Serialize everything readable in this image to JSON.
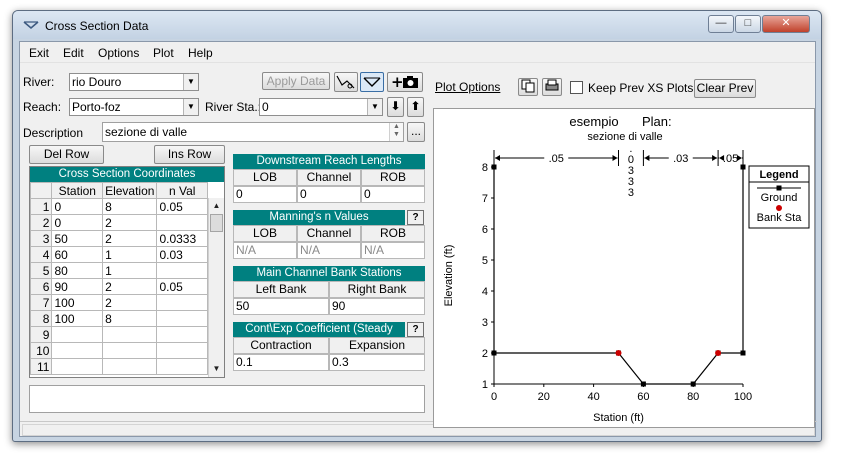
{
  "window": {
    "title": "Cross Section Data"
  },
  "titlebar_buttons": {
    "minimize": "—",
    "maximize": "□",
    "close": "✕"
  },
  "menu": [
    "Exit",
    "Edit",
    "Options",
    "Plot",
    "Help"
  ],
  "river": {
    "label": "River:",
    "value": "rio Douro"
  },
  "reach": {
    "label": "Reach:",
    "value": "Porto-foz"
  },
  "river_sta": {
    "label": "River Sta.:",
    "value": "0"
  },
  "toolbar": {
    "apply_data": "Apply Data",
    "plot_options": "Plot Options",
    "keep_prev": "Keep Prev XS Plots",
    "clear_prev": "Clear Prev"
  },
  "description": {
    "label": "Description",
    "value": "sezione di valle",
    "more": "..."
  },
  "grid_buttons": {
    "del_row": "Del Row",
    "ins_row": "Ins Row"
  },
  "coords": {
    "title": "Cross Section Coordinates",
    "headers": [
      "Station",
      "Elevation",
      "n Val"
    ],
    "rows": [
      [
        "1",
        "0",
        "8",
        "0.05"
      ],
      [
        "2",
        "0",
        "2",
        ""
      ],
      [
        "3",
        "50",
        "2",
        "0.0333"
      ],
      [
        "4",
        "60",
        "1",
        "0.03"
      ],
      [
        "5",
        "80",
        "1",
        ""
      ],
      [
        "6",
        "90",
        "2",
        "0.05"
      ],
      [
        "7",
        "100",
        "2",
        ""
      ],
      [
        "8",
        "100",
        "8",
        ""
      ],
      [
        "9",
        "",
        "",
        ""
      ],
      [
        "10",
        "",
        "",
        ""
      ],
      [
        "11",
        "",
        "",
        ""
      ]
    ]
  },
  "downstream": {
    "title": "Downstream Reach Lengths",
    "headers": [
      "LOB",
      "Channel",
      "ROB"
    ],
    "values": [
      "0",
      "0",
      "0"
    ]
  },
  "mannings": {
    "title": "Manning's n Values",
    "headers": [
      "LOB",
      "Channel",
      "ROB"
    ],
    "values": [
      "N/A",
      "N/A",
      "N/A"
    ],
    "help": "?"
  },
  "bank_stations": {
    "title": "Main Channel Bank Stations",
    "headers": [
      "Left Bank",
      "Right Bank"
    ],
    "values": [
      "50",
      "90"
    ]
  },
  "contexp": {
    "title": "Cont\\Exp Coefficient (Steady Flow)",
    "headers": [
      "Contraction",
      "Expansion"
    ],
    "values": [
      "0.1",
      "0.3"
    ],
    "help": "?"
  },
  "colors": {
    "teal": "#008080",
    "bank": "#cc0000",
    "ground": "#000000"
  },
  "chart_data": {
    "type": "line",
    "title": "esempio",
    "plan_label": "Plan:",
    "subtitle": "sezione di valle",
    "xlabel": "Station (ft)",
    "ylabel": "Elevation (ft)",
    "xlim": [
      0,
      100
    ],
    "ylim": [
      1,
      8
    ],
    "xticks": [
      "0",
      "20",
      "40",
      "60",
      "80",
      "100"
    ],
    "yticks": [
      "1",
      "2",
      "3",
      "4",
      "5",
      "6",
      "7",
      "8"
    ],
    "series": [
      {
        "name": "Ground",
        "x": [
          0,
          0,
          50,
          60,
          80,
          90,
          100,
          100
        ],
        "y": [
          8,
          2,
          2,
          1,
          1,
          2,
          2,
          8
        ]
      },
      {
        "name": "Bank Sta",
        "x": [
          50,
          90
        ],
        "y": [
          2,
          2
        ]
      }
    ],
    "n_values": [
      {
        "from": 0,
        "to": 50,
        "label": ".05"
      },
      {
        "from": 50,
        "to": 60,
        "label": "0333"
      },
      {
        "from": 60,
        "to": 90,
        "label": ".03"
      },
      {
        "from": 90,
        "to": 100,
        "label": ".05"
      }
    ],
    "legend": {
      "title": "Legend",
      "placement": "right"
    },
    "grid": false
  }
}
